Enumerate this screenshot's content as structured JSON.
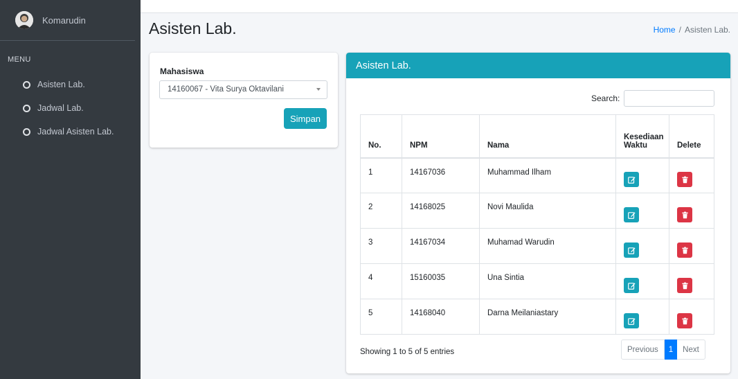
{
  "user": {
    "name": "Komarudin"
  },
  "sidebar": {
    "header": "MENU",
    "items": [
      {
        "label": "Asisten Lab."
      },
      {
        "label": "Jadwal Lab."
      },
      {
        "label": "Jadwal Asisten Lab."
      }
    ]
  },
  "page": {
    "title": "Asisten Lab."
  },
  "breadcrumb": {
    "home": "Home",
    "separator": "/",
    "current": "Asisten Lab."
  },
  "form": {
    "label": "Mahasiswa",
    "selected": "14160067 - Vita Surya Oktavilani",
    "submit_label": "Simpan"
  },
  "table_card": {
    "title": "Asisten Lab.",
    "search_label": "Search:",
    "search_value": "",
    "columns": [
      "No.",
      "NPM",
      "Nama",
      "Kesediaan Waktu",
      "Delete"
    ],
    "rows": [
      {
        "no": "1",
        "npm": "14167036",
        "nama": "Muhammad Ilham"
      },
      {
        "no": "2",
        "npm": "14168025",
        "nama": "Novi Maulida"
      },
      {
        "no": "3",
        "npm": "14167034",
        "nama": "Muhamad Warudin"
      },
      {
        "no": "4",
        "npm": "15160035",
        "nama": "Una Sintia"
      },
      {
        "no": "5",
        "npm": "14168040",
        "nama": "Darna Meilaniastary"
      }
    ],
    "info": "Showing 1 to 5 of 5 entries",
    "pagination": {
      "previous": "Previous",
      "page": "1",
      "next": "Next"
    }
  },
  "icons": {
    "edit": "edit-icon",
    "delete": "trash-icon",
    "nav": "circle-icon"
  },
  "colors": {
    "sidebar": "#343a40",
    "info": "#17a2b8",
    "danger": "#dc3545",
    "primary": "#007bff"
  }
}
